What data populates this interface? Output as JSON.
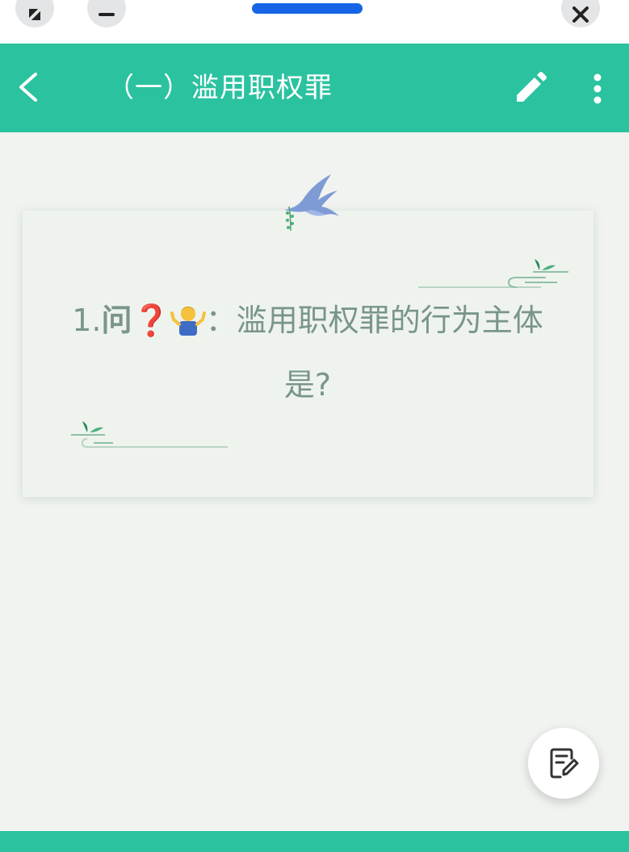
{
  "window": {
    "buttons": [
      "expand-icon",
      "minimize-icon",
      "close-icon"
    ]
  },
  "header": {
    "title": "（一）滥用职权罪",
    "back_icon": "chevron-left-icon",
    "edit_icon": "pencil-icon",
    "more_icon": "more-vertical-icon"
  },
  "card": {
    "question_number": "1.",
    "question_prefix": "问",
    "question_mark": "❓",
    "question_emoji": "shrug-person-icon",
    "question_text": "：滥用职权罪的行为主体是?"
  },
  "fab": {
    "icon": "note-edit-icon"
  },
  "colors": {
    "accent": "#2bc2a0",
    "background": "#f0f3ef",
    "question_text": "#79958c",
    "drag_handle": "#1565e6"
  }
}
